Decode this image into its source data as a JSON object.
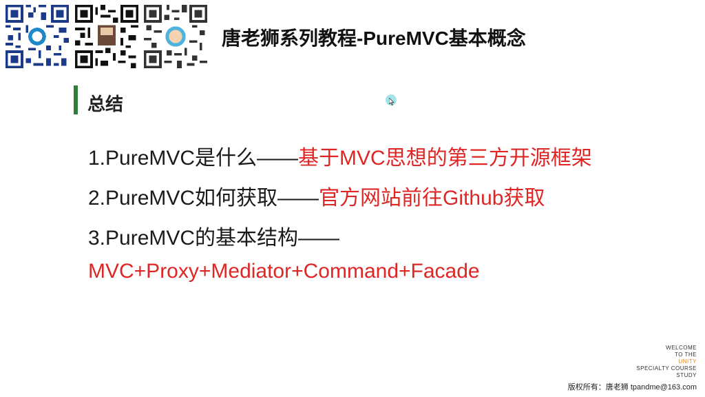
{
  "header": {
    "title": "唐老狮系列教程-PureMVC基本概念"
  },
  "section": {
    "heading": "总结"
  },
  "summary": [
    {
      "prefix": "1.PureMVC是什么——",
      "answer": "基于MVC思想的第三方开源框架"
    },
    {
      "prefix": "2.PureMVC如何获取——",
      "answer": "官方网站前往Github获取"
    },
    {
      "prefix": "3.PureMVC的基本结构——",
      "answer": ""
    }
  ],
  "summary_line4": "MVC+Proxy+Mediator+Command+Facade",
  "branding": {
    "line1": "WELCOME",
    "line2": "TO THE",
    "line3": "UNITY",
    "line4": "SPECIALTY COURSE",
    "line5": "STUDY"
  },
  "footer": {
    "copyright": "版权所有：唐老狮 tpandme@163.com"
  },
  "colors": {
    "accent_red": "#e02525",
    "section_bar": "#2e7d3a",
    "brand_orange": "#e08a1e"
  },
  "icons": [
    "qr-code-icon",
    "cursor-icon"
  ]
}
